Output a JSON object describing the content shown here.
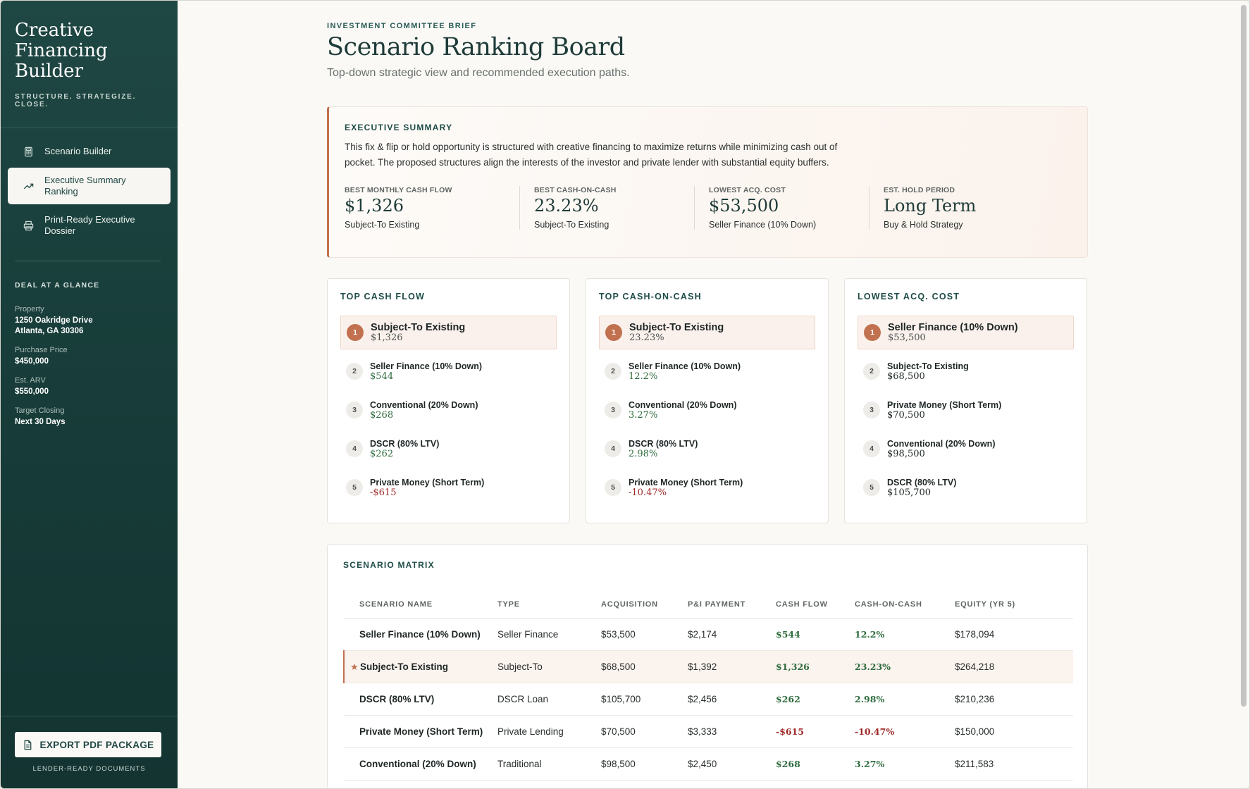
{
  "sidebar": {
    "brand_title": "Creative Financing Builder",
    "brand_tagline": "STRUCTURE. STRATEGIZE. CLOSE.",
    "nav": [
      {
        "label": "Scenario Builder",
        "icon": "calculator-icon"
      },
      {
        "label": "Executive Summary Ranking",
        "icon": "trend-up-icon"
      },
      {
        "label": "Print-Ready Executive Dossier",
        "icon": "printer-icon"
      }
    ],
    "glance": {
      "heading": "DEAL AT A GLANCE",
      "property_label": "Property",
      "property_line1": "1250 Oakridge Drive",
      "property_line2": "Atlanta, GA 30306",
      "price_label": "Purchase Price",
      "price_value": "$450,000",
      "arv_label": "Est. ARV",
      "arv_value": "$550,000",
      "closing_label": "Target Closing",
      "closing_value": "Next 30 Days"
    },
    "export_label": "EXPORT PDF PACKAGE",
    "export_sub": "LENDER-READY DOCUMENTS"
  },
  "header": {
    "eyebrow": "INVESTMENT COMMITTEE BRIEF",
    "title": "Scenario Ranking Board",
    "subtitle": "Top-down strategic view and recommended execution paths."
  },
  "summary": {
    "heading": "EXECUTIVE SUMMARY",
    "text": "This fix & flip or hold opportunity is structured with creative financing to maximize returns while minimizing cash out of pocket. The proposed structures align the interests of the investor and private lender with substantial equity buffers.",
    "metrics": [
      {
        "label": "BEST MONTHLY CASH FLOW",
        "value": "$1,326",
        "note": "Subject-To Existing"
      },
      {
        "label": "BEST CASH-ON-CASH",
        "value": "23.23%",
        "note": "Subject-To Existing"
      },
      {
        "label": "LOWEST ACQ. COST",
        "value": "$53,500",
        "note": "Seller Finance (10% Down)"
      },
      {
        "label": "EST. HOLD PERIOD",
        "value": "Long Term",
        "note": "Buy & Hold Strategy"
      }
    ]
  },
  "rankings": [
    {
      "heading": "TOP CASH FLOW",
      "items": [
        {
          "rank": "1",
          "name": "Subject-To Existing",
          "value": "$1,326",
          "tone": "pos"
        },
        {
          "rank": "2",
          "name": "Seller Finance (10% Down)",
          "value": "$544",
          "tone": "pos"
        },
        {
          "rank": "3",
          "name": "Conventional (20% Down)",
          "value": "$268",
          "tone": "pos"
        },
        {
          "rank": "4",
          "name": "DSCR (80% LTV)",
          "value": "$262",
          "tone": "pos"
        },
        {
          "rank": "5",
          "name": "Private Money (Short Term)",
          "value": "-$615",
          "tone": "neg"
        }
      ]
    },
    {
      "heading": "TOP CASH-ON-CASH",
      "items": [
        {
          "rank": "1",
          "name": "Subject-To Existing",
          "value": "23.23%",
          "tone": "pos"
        },
        {
          "rank": "2",
          "name": "Seller Finance (10% Down)",
          "value": "12.2%",
          "tone": "pos"
        },
        {
          "rank": "3",
          "name": "Conventional (20% Down)",
          "value": "3.27%",
          "tone": "pos"
        },
        {
          "rank": "4",
          "name": "DSCR (80% LTV)",
          "value": "2.98%",
          "tone": "pos"
        },
        {
          "rank": "5",
          "name": "Private Money (Short Term)",
          "value": "-10.47%",
          "tone": "neg"
        }
      ]
    },
    {
      "heading": "LOWEST ACQ. COST",
      "items": [
        {
          "rank": "1",
          "name": "Seller Finance (10% Down)",
          "value": "$53,500",
          "tone": "dark"
        },
        {
          "rank": "2",
          "name": "Subject-To Existing",
          "value": "$68,500",
          "tone": "dark"
        },
        {
          "rank": "3",
          "name": "Private Money (Short Term)",
          "value": "$70,500",
          "tone": "dark"
        },
        {
          "rank": "4",
          "name": "Conventional (20% Down)",
          "value": "$98,500",
          "tone": "dark"
        },
        {
          "rank": "5",
          "name": "DSCR (80% LTV)",
          "value": "$105,700",
          "tone": "dark"
        }
      ]
    }
  ],
  "matrix": {
    "heading": "SCENARIO MATRIX",
    "columns": [
      "SCENARIO NAME",
      "TYPE",
      "ACQUISITION",
      "P&I PAYMENT",
      "CASH FLOW",
      "CASH-ON-CASH",
      "EQUITY (YR 5)"
    ],
    "rows": [
      {
        "name": "Seller Finance (10% Down)",
        "type": "Seller Finance",
        "acq": "$53,500",
        "pi": "$2,174",
        "cf": "$544",
        "coc": "12.2%",
        "equity": "$178,094",
        "tone": "pos",
        "highlight": false
      },
      {
        "name": "Subject-To Existing",
        "type": "Subject-To",
        "acq": "$68,500",
        "pi": "$1,392",
        "cf": "$1,326",
        "coc": "23.23%",
        "equity": "$264,218",
        "tone": "pos",
        "highlight": true
      },
      {
        "name": "DSCR (80% LTV)",
        "type": "DSCR Loan",
        "acq": "$105,700",
        "pi": "$2,456",
        "cf": "$262",
        "coc": "2.98%",
        "equity": "$210,236",
        "tone": "pos",
        "highlight": false
      },
      {
        "name": "Private Money (Short Term)",
        "type": "Private Lending",
        "acq": "$70,500",
        "pi": "$3,333",
        "cf": "-$615",
        "coc": "-10.47%",
        "equity": "$150,000",
        "tone": "neg",
        "highlight": false
      },
      {
        "name": "Conventional (20% Down)",
        "type": "Traditional",
        "acq": "$98,500",
        "pi": "$2,450",
        "cf": "$268",
        "coc": "3.27%",
        "equity": "$211,583",
        "tone": "pos",
        "highlight": false
      }
    ]
  },
  "colors": {
    "sidebar": "#1f4743",
    "accent": "#c1714f",
    "positive": "#2e6b3d",
    "negative": "#a02a2a"
  }
}
